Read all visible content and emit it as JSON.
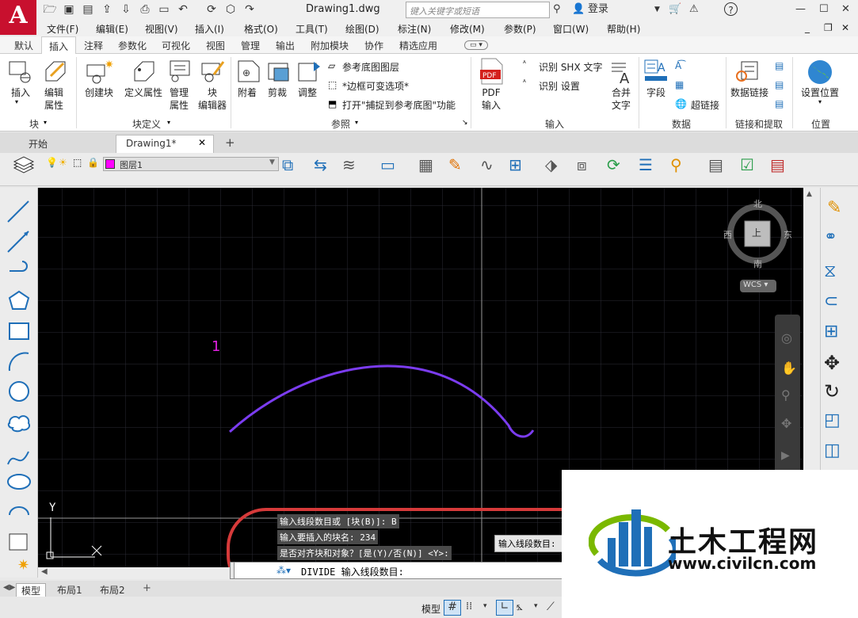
{
  "app": {
    "logo_letter": "A",
    "document_title": "Drawing1.dwg",
    "search_placeholder": "键入关键字或短语",
    "login_label": "登录"
  },
  "menubar": [
    "文件(F)",
    "编辑(E)",
    "视图(V)",
    "插入(I)",
    "格式(O)",
    "工具(T)",
    "绘图(D)",
    "标注(N)",
    "修改(M)",
    "参数(P)",
    "窗口(W)",
    "帮助(H)"
  ],
  "ribbon_tabs": [
    "默认",
    "插入",
    "注释",
    "参数化",
    "可视化",
    "视图",
    "管理",
    "输出",
    "附加模块",
    "协作",
    "精选应用"
  ],
  "ribbon_active_tab": "插入",
  "ribbon": {
    "block_group": {
      "label": "块",
      "insert": "插入",
      "edit_attr": "编辑\n属性"
    },
    "blockdef_group": {
      "label": "块定义",
      "create": "创建块",
      "define_attr": "定义属性",
      "manage_attr": "管理\n属性",
      "block_editor": "块\n编辑器"
    },
    "reference_group": {
      "label": "参照",
      "attach": "附着",
      "clip": "剪裁",
      "adjust": "调整",
      "underlay_layers": "参考底图图层",
      "frame_variable": "*边框可变选项*",
      "snap_underlay": "打开\"捕捉到参考底图\"功能"
    },
    "import_group": {
      "label": "输入",
      "pdf_import": "PDF\n输入",
      "recognize_shx": "识别 SHX 文字",
      "recognize_settings": "识别 设置",
      "combine_text": "合并\n文字"
    },
    "data_group": {
      "label": "数据",
      "field": "字段",
      "hyperlink": "超链接"
    },
    "link_group": {
      "label": "链接和提取",
      "data_link": "数据链接"
    },
    "location_group": {
      "label": "位置",
      "set_location": "设置位置"
    }
  },
  "doc_tabs": {
    "start": "开始",
    "current": "Drawing1*"
  },
  "layer": {
    "name": "图层1",
    "color": "#ff00ff"
  },
  "viewcube": {
    "north": "北",
    "south": "南",
    "east": "东",
    "west": "西",
    "top": "上",
    "wcs": "WCS"
  },
  "canvas": {
    "annotation_label": "1",
    "annotation_color": "#e020e0",
    "arc_color": "#7b3cf0",
    "axis_y": "Y"
  },
  "command": {
    "history": [
      "输入线段数目或 [块(B)]: B",
      "输入要插入的块名: 234",
      "是否对齐块和对象？[是(Y)/否(N)] <Y>:"
    ],
    "prompt": "DIVIDE 输入线段数目:",
    "tooltip": "输入线段数目:"
  },
  "layout_tabs": [
    "模型",
    "布局1",
    "布局2"
  ],
  "statusbar": {
    "model_label": "模型"
  },
  "watermark": {
    "title": "土木工程网",
    "url": "www.civilcn.com"
  }
}
